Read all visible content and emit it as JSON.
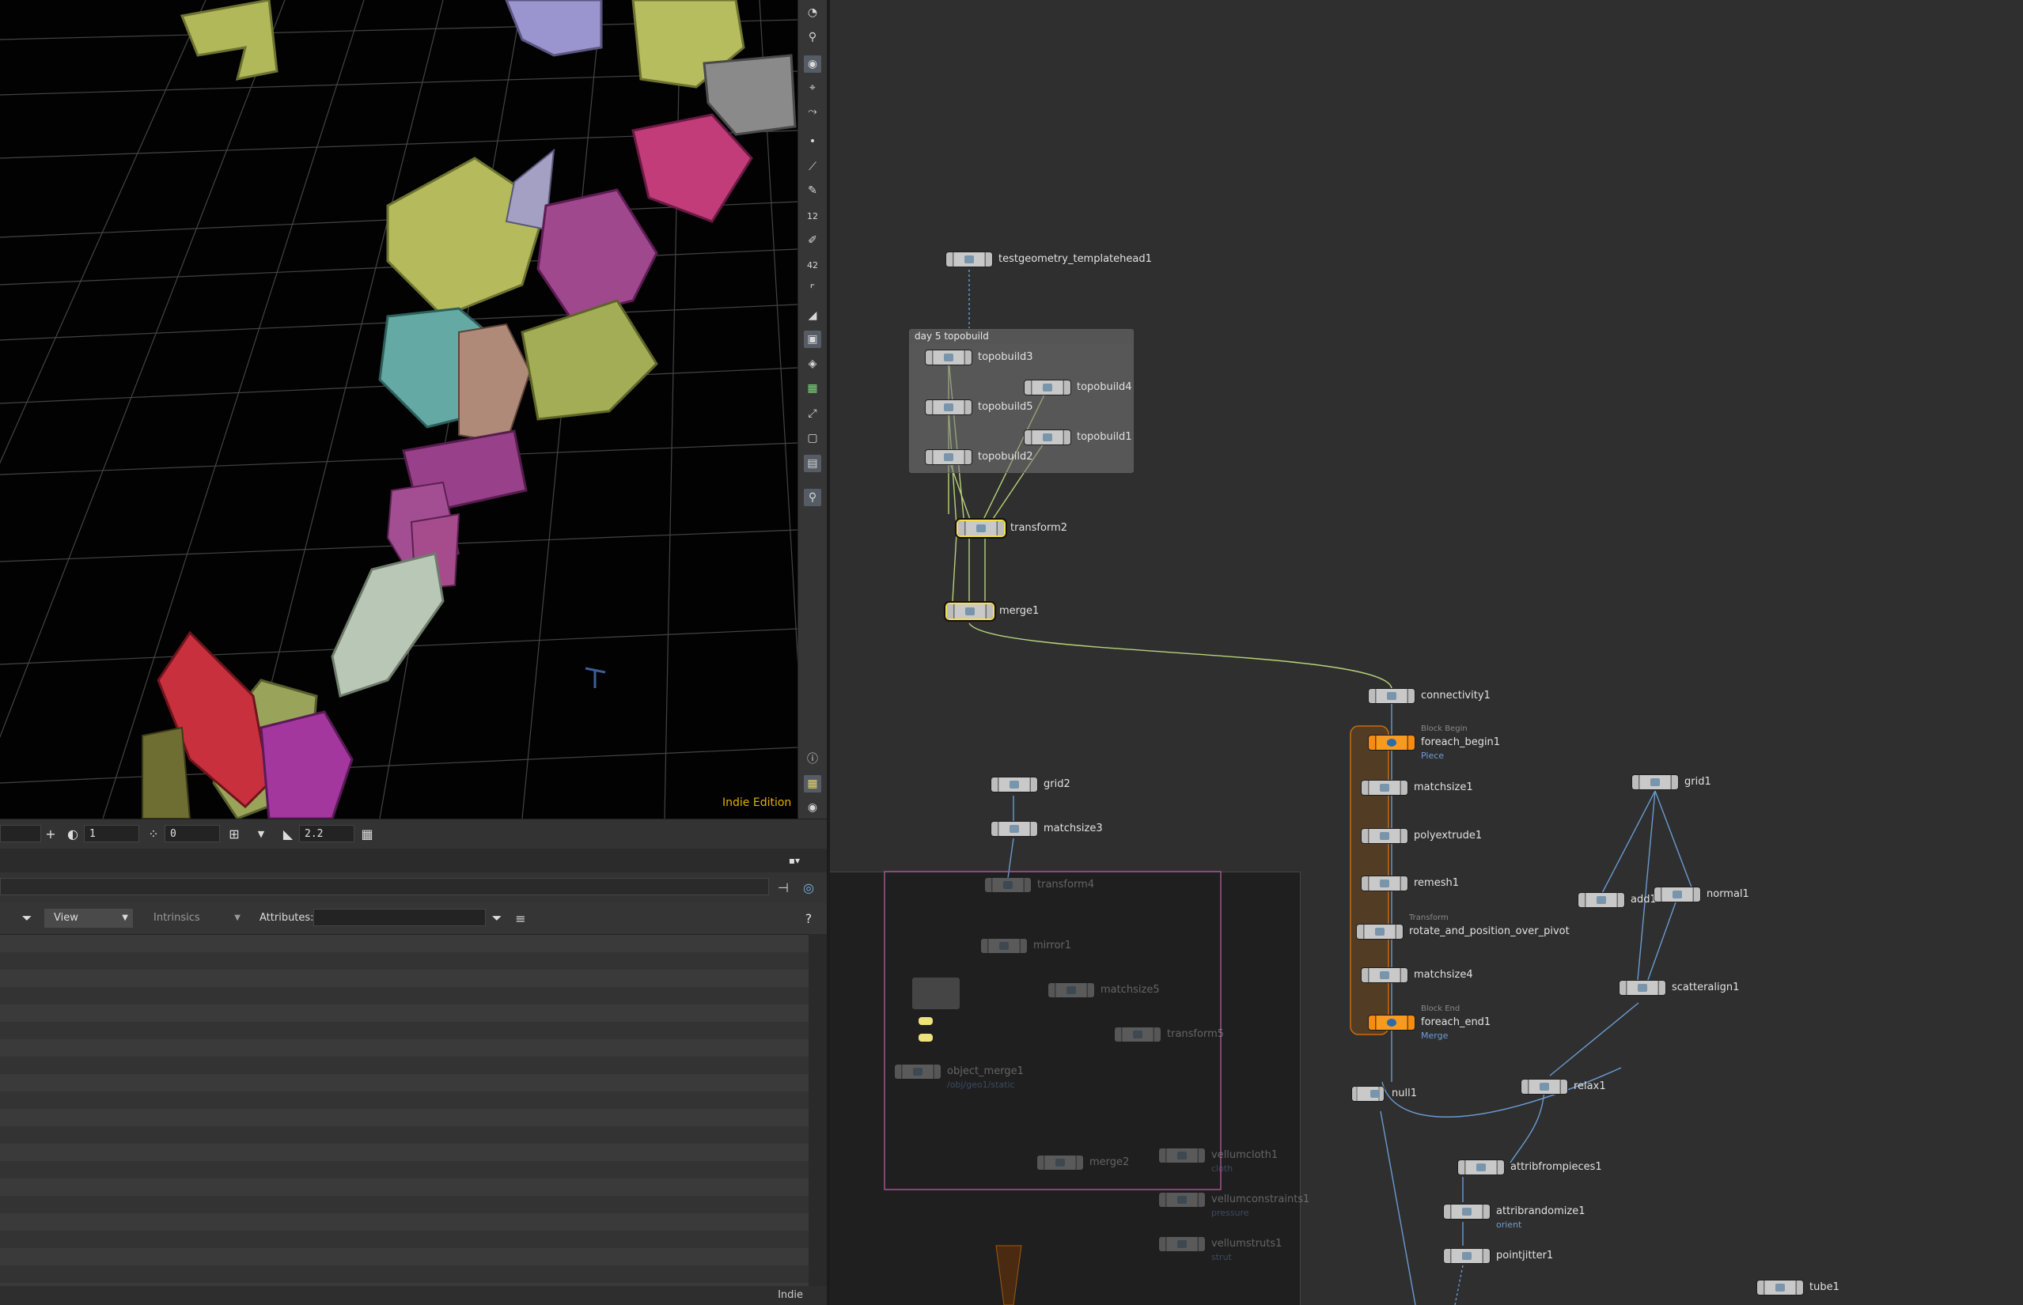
{
  "viewport": {
    "watermark": "Indie Edition"
  },
  "viewport_toolbar": {
    "icons": [
      "light-icon",
      "camera-light-icon",
      "display-options-icon",
      "snap-icon",
      "handle-icon",
      "point-icon",
      "edge-icon",
      "brush-icon",
      "number-12-icon",
      "paint-icon",
      "number-42-icon",
      "angle-icon",
      "cut-icon",
      "xray-icon",
      "layer-icon",
      "map-icon",
      "pick-icon",
      "box-icon",
      "render-icon",
      "pin-icon",
      "info-icon",
      "grid-view-icon",
      "eye-icon"
    ],
    "badge_12": "12",
    "badge_42": "42"
  },
  "bottombar": {
    "plus": "+",
    "field1": "1",
    "field2": "0",
    "field3": "2.2"
  },
  "spreadsheet": {
    "view_label": "View",
    "intrinsics_label": "Intrinsics",
    "attributes_label": "Attributes:",
    "help": "?",
    "footer": "Indie"
  },
  "network": {
    "netbox": {
      "title": "day 5 topobuild"
    },
    "nodes": [
      {
        "id": "testgeometry_templatehead1",
        "label": "testgeometry_templatehead1"
      },
      {
        "id": "topobuild3",
        "label": "topobuild3"
      },
      {
        "id": "topobuild4",
        "label": "topobuild4"
      },
      {
        "id": "topobuild5",
        "label": "topobuild5"
      },
      {
        "id": "topobuild1",
        "label": "topobuild1"
      },
      {
        "id": "topobuild2",
        "label": "topobuild2"
      },
      {
        "id": "transform2",
        "label": "transform2"
      },
      {
        "id": "merge1",
        "label": "merge1"
      },
      {
        "id": "connectivity1",
        "label": "connectivity1"
      },
      {
        "id": "foreach_begin1",
        "label": "foreach_begin1",
        "over": "Block Begin",
        "sub": "Piece"
      },
      {
        "id": "matchsize1",
        "label": "matchsize1"
      },
      {
        "id": "polyextrude1",
        "label": "polyextrude1"
      },
      {
        "id": "remesh1",
        "label": "remesh1"
      },
      {
        "id": "rotate_and_position_over_pivot",
        "label": "rotate_and_position_over_pivot",
        "over": "Transform"
      },
      {
        "id": "matchsize4",
        "label": "matchsize4"
      },
      {
        "id": "foreach_end1",
        "label": "foreach_end1",
        "over": "Block End",
        "sub": "Merge"
      },
      {
        "id": "null1",
        "label": "null1"
      },
      {
        "id": "grid2",
        "label": "grid2"
      },
      {
        "id": "matchsize3",
        "label": "matchsize3"
      },
      {
        "id": "grid1",
        "label": "grid1"
      },
      {
        "id": "add1",
        "label": "add1"
      },
      {
        "id": "normal1",
        "label": "normal1"
      },
      {
        "id": "scatteralign1",
        "label": "scatteralign1"
      },
      {
        "id": "relax1",
        "label": "relax1"
      },
      {
        "id": "attribfrompieces1",
        "label": "attribfrompieces1"
      },
      {
        "id": "attribrandomize1",
        "label": "attribrandomize1",
        "sub": "orient"
      },
      {
        "id": "pointjitter1",
        "label": "pointjitter1"
      },
      {
        "id": "tube1",
        "label": "tube1"
      },
      {
        "id": "transform4",
        "label": "transform4"
      },
      {
        "id": "mirror1",
        "label": "mirror1"
      },
      {
        "id": "matchsize5",
        "label": "matchsize5"
      },
      {
        "id": "transform5",
        "label": "transform5"
      },
      {
        "id": "object_merge1",
        "label": "object_merge1",
        "sub": "/obj/geo1/static"
      },
      {
        "id": "merge2",
        "label": "merge2"
      },
      {
        "id": "vellumcloth1",
        "label": "vellumcloth1",
        "sub": "cloth"
      },
      {
        "id": "vellumconstraints1",
        "label": "vellumconstraints1",
        "sub": "pressure"
      },
      {
        "id": "vellumstruts1",
        "label": "vellumstruts1",
        "sub": "strut"
      }
    ]
  },
  "colors": {
    "selection": "#f4e04a",
    "foreach": "#f28c14",
    "wire_blue": "#6a9ad0",
    "wire_green": "#b7d27a"
  }
}
